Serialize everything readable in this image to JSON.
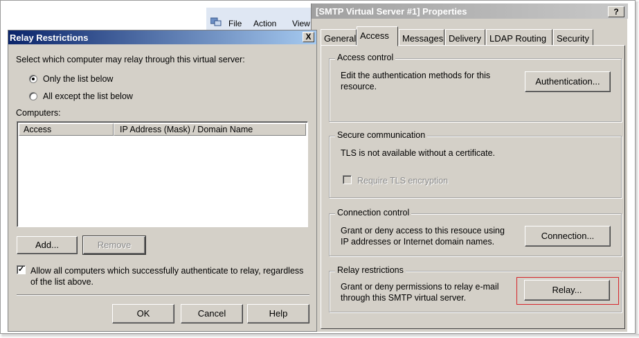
{
  "mmc": {
    "menu": [
      "File",
      "Action",
      "View"
    ],
    "icon": "mmc-snapin-icon"
  },
  "properties": {
    "title": "[SMTP Virtual Server #1] Properties",
    "help_label": "?",
    "tabs": [
      "General",
      "Access",
      "Messages",
      "Delivery",
      "LDAP Routing",
      "Security"
    ],
    "active_tab": "Access",
    "access_control": {
      "legend": "Access control",
      "text": [
        "Edit the authentication methods for this",
        "resource."
      ],
      "button": "Authentication..."
    },
    "secure_communication": {
      "legend": "Secure communication",
      "text": "TLS is not available without a certificate.",
      "checkbox_label": "Require TLS encryption",
      "checkbox_checked": false,
      "checkbox_enabled": false
    },
    "connection_control": {
      "legend": "Connection control",
      "text": [
        "Grant or deny access to this resouce using",
        "IP addresses or Internet domain names."
      ],
      "button": "Connection..."
    },
    "relay_restrictions": {
      "legend": "Relay restrictions",
      "text": [
        "Grant or deny permissions to relay e-mail",
        "through this SMTP virtual server."
      ],
      "button": "Relay...",
      "highlight_color": "#d6252a"
    }
  },
  "relay_dialog": {
    "title": "Relay Restrictions",
    "close_label": "X",
    "prompt": "Select which computer may relay through this virtual server:",
    "options": [
      {
        "label": "Only the list below",
        "selected": true
      },
      {
        "label": "All except the list below",
        "selected": false
      }
    ],
    "computers_label": "Computers:",
    "columns": [
      "Access",
      "IP Address (Mask) / Domain Name"
    ],
    "rows": [],
    "add_button": "Add...",
    "remove_button": "Remove",
    "allow_auth_checked": true,
    "allow_auth_text": [
      "Allow all computers which successfully authenticate to relay, regardless",
      "of the list above."
    ],
    "ok_button": "OK",
    "cancel_button": "Cancel",
    "help_button": "Help",
    "title_color_start": "#0a246a",
    "title_color_end": "#a6caf0"
  }
}
